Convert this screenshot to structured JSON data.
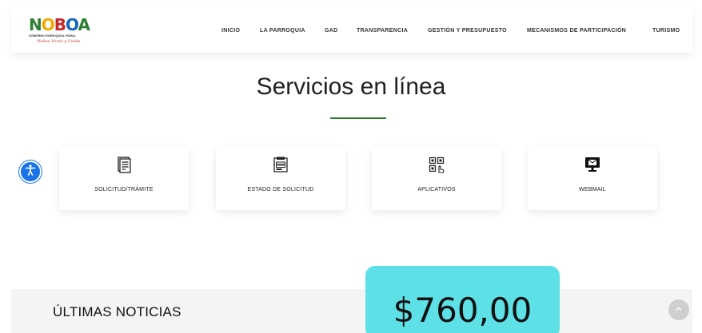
{
  "header": {
    "logo": {
      "word_parts": [
        "N",
        "O",
        "B",
        "O",
        "A"
      ],
      "subtitle": "GOBIERNO PARROQUIAL RURAL",
      "tagline": "Noboa Verde y Unida"
    },
    "nav": [
      {
        "label": "INICIO"
      },
      {
        "label": "LA PARROQUIA"
      },
      {
        "label": "GAD"
      },
      {
        "label": "TRANSPARENCIA"
      },
      {
        "label": "GESTIÓN Y PRESUPUESTO"
      },
      {
        "label": "MECANISMOS DE PARTICIPACIÓN"
      },
      {
        "label": "TURISMO"
      }
    ]
  },
  "main": {
    "title": "Servicios en línea",
    "services": [
      {
        "label": "SOLICITUD/TRÁMITE",
        "icon": "document-icon"
      },
      {
        "label": "ESTADO DE SOLICITUD",
        "icon": "form-status-icon"
      },
      {
        "label": "APLICATIVOS",
        "icon": "apps-grid-icon"
      },
      {
        "label": "WEBMAIL",
        "icon": "monitor-mail-icon"
      }
    ]
  },
  "footer": {
    "news_heading": "ÚLTIMAS NOTICIAS"
  },
  "overlay": {
    "price": "$760,00"
  },
  "colors": {
    "accent_green": "#2e7d32",
    "accessibility_blue": "#1a73e8",
    "price_bg": "#5ee1e6"
  }
}
